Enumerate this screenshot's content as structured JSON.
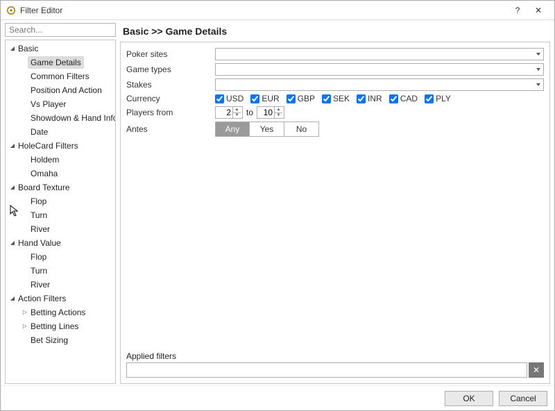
{
  "window": {
    "title": "Filter Editor"
  },
  "search": {
    "placeholder": "Search..."
  },
  "tree": [
    {
      "label": "Basic",
      "expanded": true,
      "children": [
        {
          "label": "Game Details",
          "selected": true
        },
        {
          "label": "Common Filters"
        },
        {
          "label": "Position And Action"
        },
        {
          "label": "Vs Player"
        },
        {
          "label": "Showdown & Hand Info"
        },
        {
          "label": "Date"
        }
      ]
    },
    {
      "label": "HoleCard Filters",
      "expanded": true,
      "children": [
        {
          "label": "Holdem"
        },
        {
          "label": "Omaha"
        }
      ]
    },
    {
      "label": "Board Texture",
      "expanded": true,
      "children": [
        {
          "label": "Flop"
        },
        {
          "label": "Turn"
        },
        {
          "label": "River"
        }
      ]
    },
    {
      "label": "Hand Value",
      "expanded": true,
      "children": [
        {
          "label": "Flop"
        },
        {
          "label": "Turn"
        },
        {
          "label": "River"
        }
      ]
    },
    {
      "label": "Action Filters",
      "expanded": true,
      "children": [
        {
          "label": "Betting Actions",
          "hasChildren": true
        },
        {
          "label": "Betting Lines",
          "hasChildren": true
        },
        {
          "label": "Bet Sizing"
        }
      ]
    }
  ],
  "breadcrumb": "Basic >> Game Details",
  "form": {
    "poker_sites_label": "Poker sites",
    "game_types_label": "Game types",
    "stakes_label": "Stakes",
    "currency_label": "Currency",
    "currencies": [
      {
        "code": "USD",
        "checked": true
      },
      {
        "code": "EUR",
        "checked": true
      },
      {
        "code": "GBP",
        "checked": true
      },
      {
        "code": "SEK",
        "checked": true
      },
      {
        "code": "INR",
        "checked": true
      },
      {
        "code": "CAD",
        "checked": true
      },
      {
        "code": "PLY",
        "checked": true
      }
    ],
    "players_from_label": "Players from",
    "players_from": "2",
    "players_to_word": "to",
    "players_to": "10",
    "antes_label": "Antes",
    "antes_options": [
      "Any",
      "Yes",
      "No"
    ],
    "antes_selected": "Any"
  },
  "applied": {
    "label": "Applied filters",
    "value": "",
    "clear_icon": "✕"
  },
  "footer": {
    "ok": "OK",
    "cancel": "Cancel"
  }
}
